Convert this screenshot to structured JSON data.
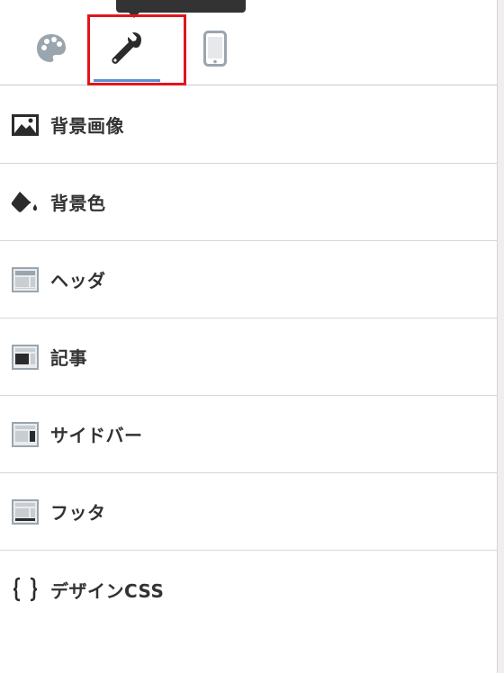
{
  "tabs": [
    {
      "name": "palette",
      "icon": "palette-icon"
    },
    {
      "name": "settings",
      "icon": "wrench-icon",
      "active": true
    },
    {
      "name": "mobile",
      "icon": "mobile-icon"
    }
  ],
  "colors": {
    "active_underline": "#5a8fd0",
    "highlight_box": "#e3141c",
    "icon_gray": "#9aa5ae",
    "text": "#333333"
  },
  "menu": {
    "items": [
      {
        "label": "背景画像",
        "icon": "image-icon"
      },
      {
        "label": "背景色",
        "icon": "paint-bucket-icon"
      },
      {
        "label": "ヘッダ",
        "icon": "layout-header-icon"
      },
      {
        "label": "記事",
        "icon": "layout-article-icon"
      },
      {
        "label": "サイドバー",
        "icon": "layout-sidebar-icon"
      },
      {
        "label": "フッタ",
        "icon": "layout-footer-icon"
      },
      {
        "label": "デザインCSS",
        "icon": "braces-icon"
      }
    ]
  }
}
